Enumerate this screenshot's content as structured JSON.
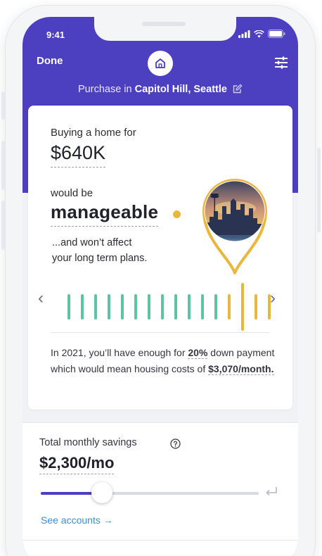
{
  "status_bar": {
    "time": "9:41"
  },
  "header": {
    "done_label": "Done",
    "logo_icon": "home-icon",
    "settings_icon": "sliders-icon",
    "location_prefix": "Purchase in ",
    "location_name": "Capitol Hill, Seattle",
    "accent_color": "#4c3fc0"
  },
  "result_card": {
    "buy_label": "Buying a home for",
    "price": "$640K",
    "would_be_label": "would be",
    "verdict": "manageable",
    "verdict_color": "#e9b73e",
    "subtext_line1": "...and won’t affect",
    "subtext_line2": "your long term plans.",
    "image_subject": "Seattle skyline",
    "gauge": {
      "segment_colors": [
        "#5cc4a0",
        "#5cc4a0",
        "#5cc4a0",
        "#5cc4a0",
        "#5cc4a0",
        "#5cc4a0",
        "#5cc4a0",
        "#5cc4a0",
        "#5cc4a0",
        "#5cc4a0",
        "#5cc4a0",
        "#5cc4a0",
        "#e9b73e",
        "#e9b73e",
        "#e9b73e",
        "#e9b73e"
      ],
      "current_index": 13
    },
    "summary": {
      "part1": "In 2021, you’ll have enough for ",
      "down_payment": "20%",
      "part2": " down payment which would mean housing costs of ",
      "monthly_cost": "$3,070/month."
    }
  },
  "savings": {
    "label": "Total monthly savings",
    "value": "$2,300/mo",
    "slider_fraction": 0.28,
    "link": "See accounts →"
  }
}
